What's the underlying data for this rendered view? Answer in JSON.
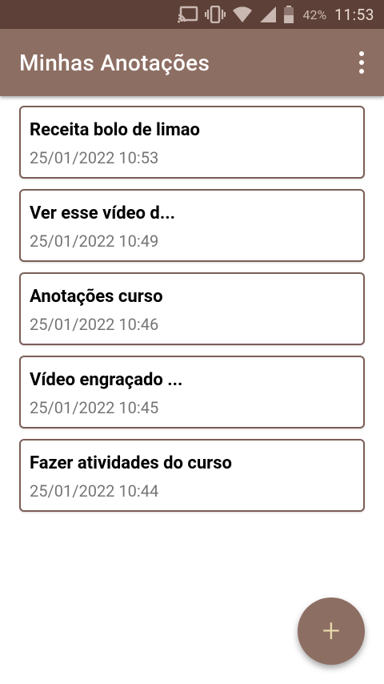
{
  "status_bar": {
    "icons": [
      "cast-icon",
      "vibrate-icon",
      "wifi-icon",
      "signal-icon",
      "battery-icon"
    ],
    "battery_percent": "42%",
    "time": "11:53"
  },
  "app_bar": {
    "title": "Minhas Anotações",
    "overflow_icon": "more-vert-icon"
  },
  "notes": [
    {
      "title": "Receita bolo de limao",
      "date": "25/01/2022 10:53"
    },
    {
      "title": "Ver esse vídeo d...",
      "date": "25/01/2022 10:49"
    },
    {
      "title": "Anotações curso",
      "date": "25/01/2022 10:46"
    },
    {
      "title": "Vídeo engraçado ...",
      "date": "25/01/2022 10:45"
    },
    {
      "title": "Fazer atividades do curso",
      "date": "25/01/2022 10:44"
    }
  ],
  "fab": {
    "label": "+",
    "icon": "add-icon"
  },
  "colors": {
    "status_bar": "#5d4037",
    "app_bar": "#8d6e63",
    "card_border": "#7b5e57",
    "fab": "#8d6e63",
    "fab_plus": "#e6d9a9",
    "date_text": "#757575"
  }
}
